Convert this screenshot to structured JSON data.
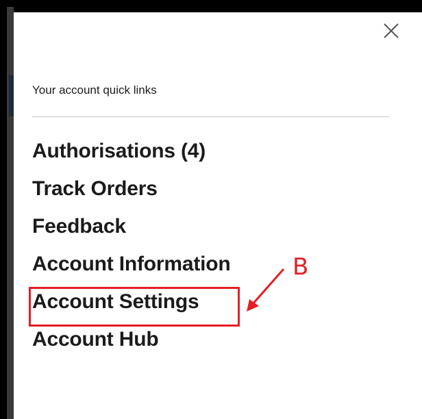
{
  "panel": {
    "heading": "Your account quick links",
    "close_icon": "close-icon"
  },
  "links": [
    {
      "label": "Authorisations  (4)"
    },
    {
      "label": "Track Orders"
    },
    {
      "label": "Feedback"
    },
    {
      "label": "Account Information"
    },
    {
      "label": "Account Settings"
    },
    {
      "label": "Account Hub"
    }
  ],
  "annotation": {
    "label": "B",
    "color": "#e41e26"
  }
}
